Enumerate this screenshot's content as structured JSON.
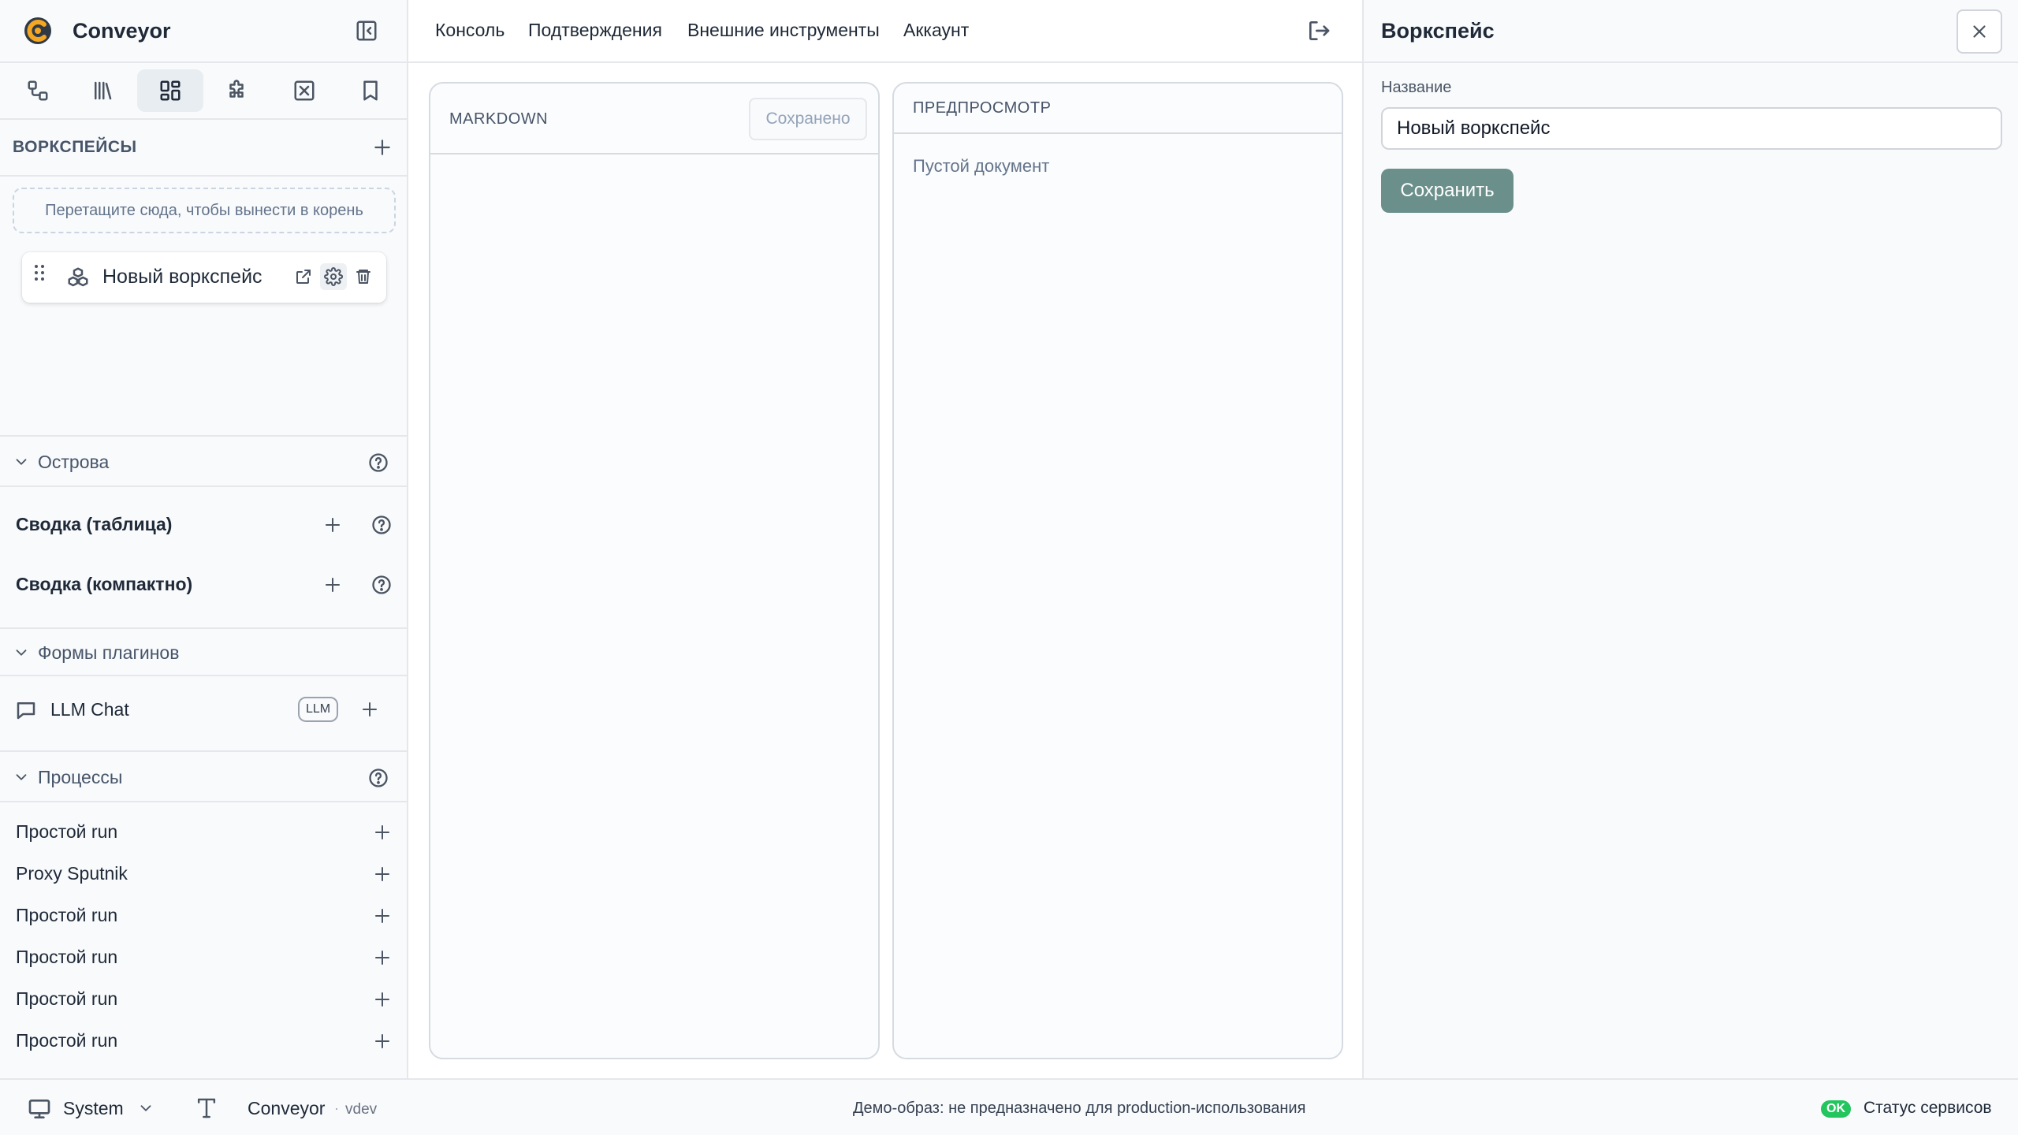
{
  "app": {
    "name": "Conveyor",
    "brand_color": "#f5a623"
  },
  "sidebar": {
    "workspaces_title": "ВОРКСПЕЙСЫ",
    "dropzone_text": "Перетащите сюда, чтобы вынести в корень",
    "workspace_item": {
      "name": "Новый воркспейс"
    },
    "islands": {
      "title": "Острова",
      "items": [
        {
          "label": "Сводка (таблица)"
        },
        {
          "label": "Сводка (компактно)"
        }
      ]
    },
    "plugin_forms": {
      "title": "Формы плагинов",
      "items": [
        {
          "label": "LLM Chat",
          "badge": "LLM"
        }
      ]
    },
    "processes": {
      "title": "Процессы",
      "items": [
        {
          "label": "Простой run"
        },
        {
          "label": "Proxy Sputnik"
        },
        {
          "label": "Простой run"
        },
        {
          "label": "Простой run"
        },
        {
          "label": "Простой run"
        },
        {
          "label": "Простой run"
        }
      ]
    }
  },
  "topnav": {
    "items": [
      {
        "label": "Консоль"
      },
      {
        "label": "Подтверждения"
      },
      {
        "label": "Внешние инструменты"
      },
      {
        "label": "Аккаунт"
      }
    ]
  },
  "editor": {
    "markdown_title": "MARKDOWN",
    "saved_label": "Сохранено",
    "preview_title": "ПРЕДПРОСМОТР",
    "preview_empty": "Пустой документ"
  },
  "rightpanel": {
    "title": "Воркспейс",
    "name_label": "Название",
    "name_value": "Новый воркспейс",
    "save_label": "Сохранить",
    "save_color": "#6b8f8a"
  },
  "footer": {
    "theme": "System",
    "app_name": "Conveyor",
    "separator": "·",
    "version": "vdev",
    "demo_notice": "Демо-образ: не предназначено для production-использования",
    "status_badge": "OK",
    "status_label": "Статус сервисов"
  }
}
